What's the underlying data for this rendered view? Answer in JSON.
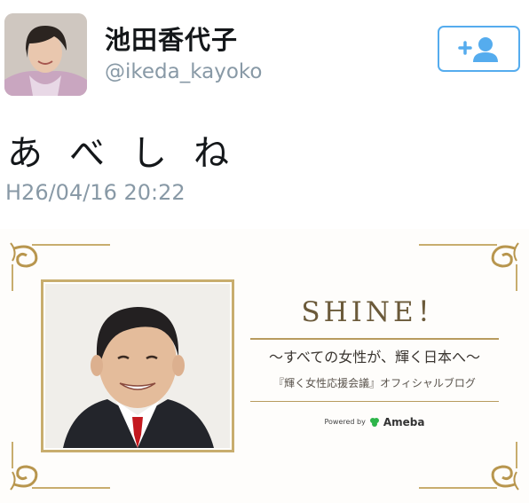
{
  "profile": {
    "display_name": "池田香代子",
    "handle": "@ikeda_kayoko",
    "avatar_icon": "profile-photo-avatar"
  },
  "follow_button": {
    "icon": "follow-person-plus-icon",
    "color": "#55acee"
  },
  "tweet": {
    "text": "あべしね",
    "timestamp": "H26/04/16 20:22"
  },
  "card": {
    "title": "SHINE！",
    "subtitle": "〜すべての女性が、輝く日本へ〜",
    "subtitle2": "『輝く女性応援会議』オフィシャルブログ",
    "powered_by": "Powered by",
    "brand": "Ameba",
    "accent_color": "#c8ad6e"
  }
}
